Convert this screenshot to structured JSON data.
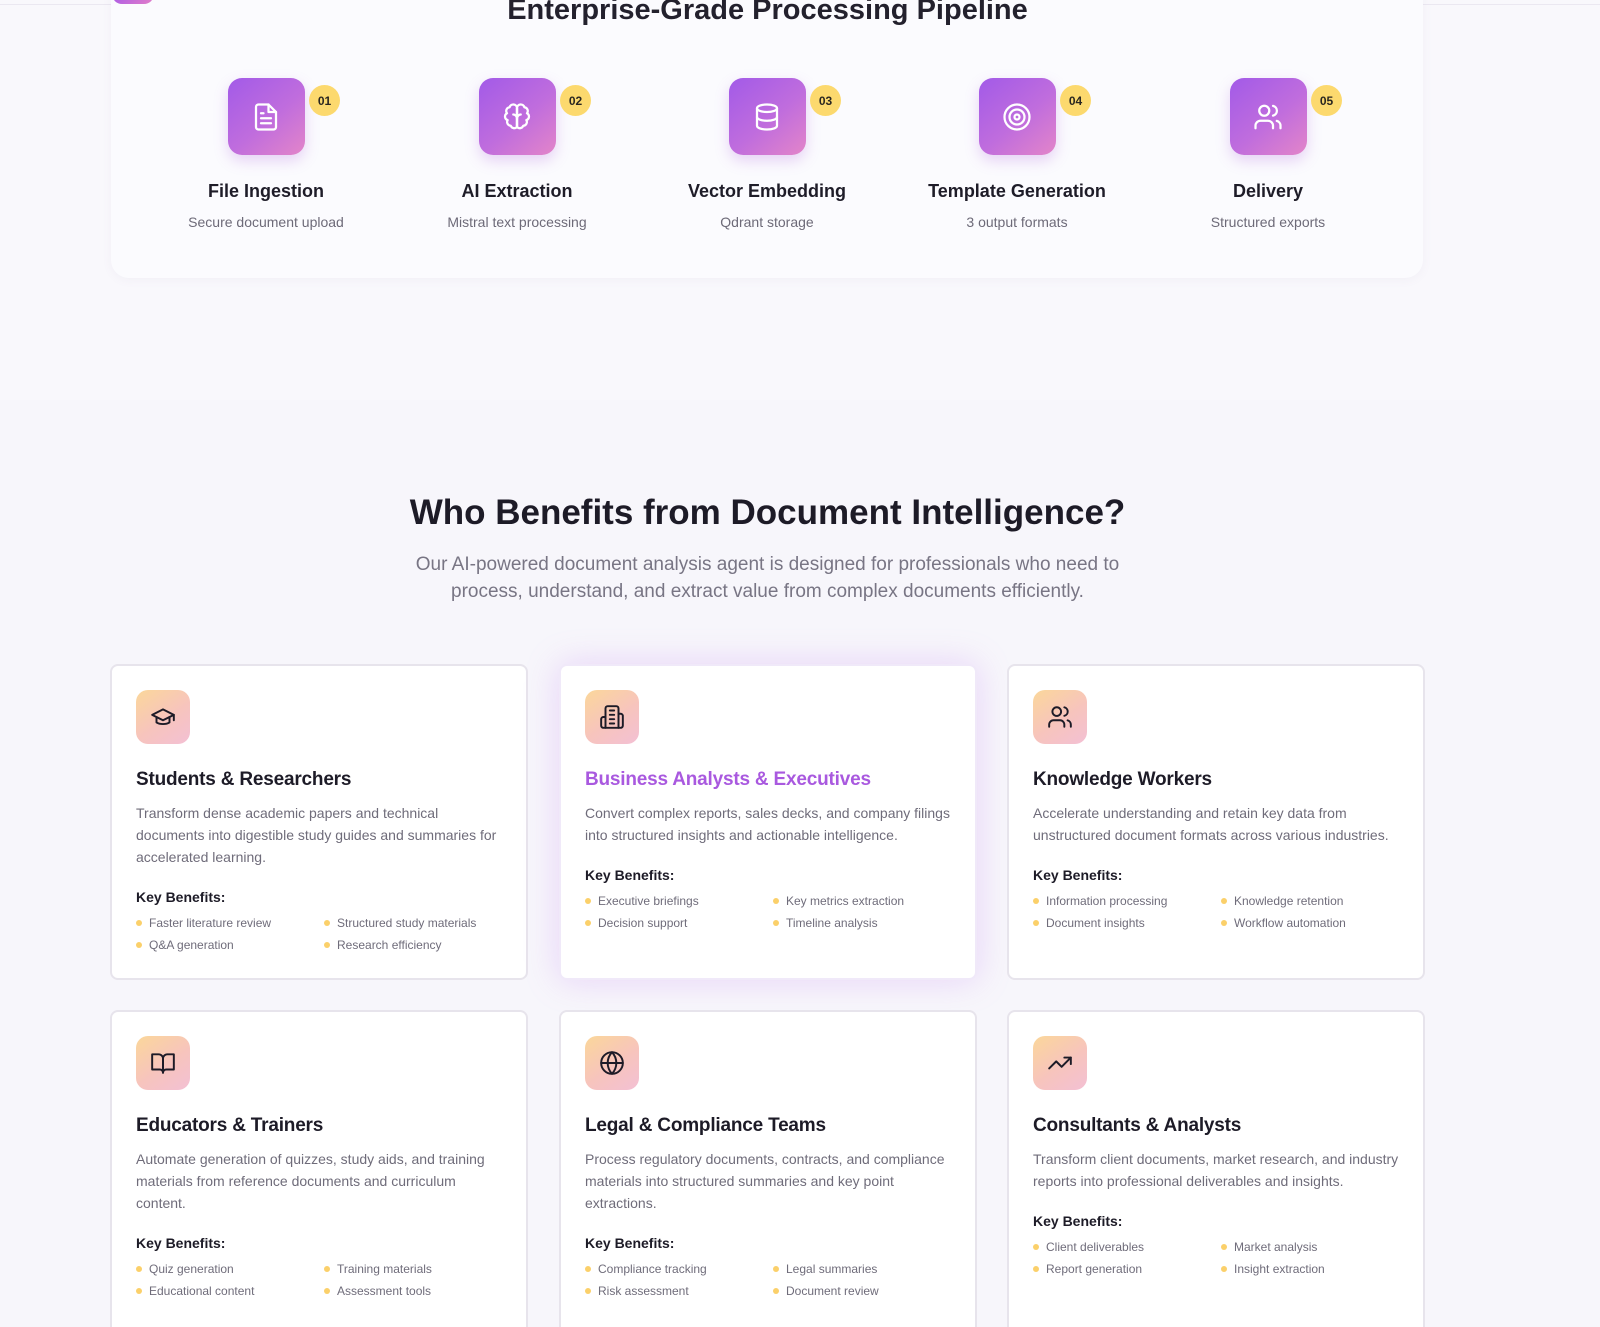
{
  "pipeline": {
    "title": "Enterprise-Grade Processing Pipeline",
    "steps": [
      {
        "number": "01",
        "name": "File Ingestion",
        "description": "Secure document upload",
        "icon": "file-text-icon"
      },
      {
        "number": "02",
        "name": "AI Extraction",
        "description": "Mistral text processing",
        "icon": "brain-icon"
      },
      {
        "number": "03",
        "name": "Vector Embedding",
        "description": "Qdrant storage",
        "icon": "database-icon"
      },
      {
        "number": "04",
        "name": "Template Generation",
        "description": "3 output formats",
        "icon": "target-icon"
      },
      {
        "number": "05",
        "name": "Delivery",
        "description": "Structured exports",
        "icon": "users-icon"
      }
    ]
  },
  "audience": {
    "title": "Who Benefits from Document Intelligence?",
    "subtitle": "Our AI-powered document analysis agent is designed for professionals who need to process, understand, and extract value from complex documents efficiently.",
    "key_benefits_label": "Key Benefits:",
    "cards": [
      {
        "icon": "graduation-cap-icon",
        "title": "Students & Researchers",
        "description": "Transform dense academic papers and technical documents into digestible study guides and summaries for accelerated learning.",
        "benefits": [
          "Faster literature review",
          "Structured study materials",
          "Q&A generation",
          "Research efficiency"
        ]
      },
      {
        "icon": "building-icon",
        "title": "Business Analysts & Executives",
        "description": "Convert complex reports, sales decks, and company filings into structured insights and actionable intelligence.",
        "benefits": [
          "Executive briefings",
          "Key metrics extraction",
          "Decision support",
          "Timeline analysis"
        ]
      },
      {
        "icon": "users-icon",
        "title": "Knowledge Workers",
        "description": "Accelerate understanding and retain key data from unstructured document formats across various industries.",
        "benefits": [
          "Information processing",
          "Knowledge retention",
          "Document insights",
          "Workflow automation"
        ]
      },
      {
        "icon": "book-open-icon",
        "title": "Educators & Trainers",
        "description": "Automate generation of quizzes, study aids, and training materials from reference documents and curriculum content.",
        "benefits": [
          "Quiz generation",
          "Training materials",
          "Educational content",
          "Assessment tools"
        ]
      },
      {
        "icon": "globe-icon",
        "title": "Legal & Compliance Teams",
        "description": "Process regulatory documents, contracts, and compliance materials into structured summaries and key point extractions.",
        "benefits": [
          "Compliance tracking",
          "Legal summaries",
          "Risk assessment",
          "Document review"
        ]
      },
      {
        "icon": "trending-up-icon",
        "title": "Consultants & Analysts",
        "description": "Transform client documents, market research, and industry reports into professional deliverables and insights.",
        "benefits": [
          "Client deliverables",
          "Market analysis",
          "Report generation",
          "Insight extraction"
        ]
      }
    ]
  },
  "colors": {
    "brand_gradient_start": "#a25ae8",
    "brand_gradient_end": "#e385c9",
    "badge": "#fcd96e",
    "highlight_title": "#a959df",
    "bullet": "#fbd06a"
  }
}
